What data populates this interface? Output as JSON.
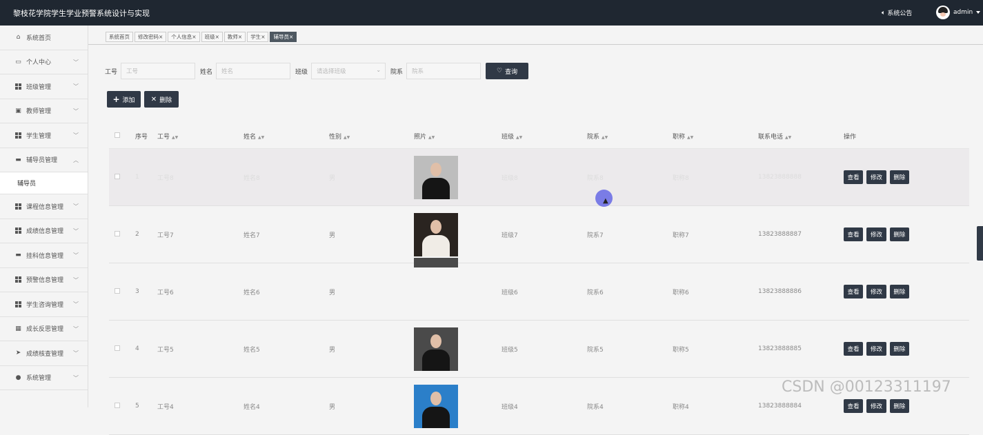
{
  "header": {
    "title": "黎枝花学院学生学业预警系统设计与实现",
    "notice_label": "系统公告",
    "username": "admin"
  },
  "sidebar": {
    "items": [
      {
        "label": "系统首页",
        "icon": "home-icon",
        "expanded": false
      },
      {
        "label": "个人中心",
        "icon": "profile-icon",
        "expanded": false
      },
      {
        "label": "班级管理",
        "icon": "grid-icon",
        "expanded": false
      },
      {
        "label": "教师管理",
        "icon": "clipboard-icon",
        "expanded": false
      },
      {
        "label": "学生管理",
        "icon": "grid-icon",
        "expanded": false
      },
      {
        "label": "辅导员管理",
        "icon": "monitor-icon",
        "expanded": true
      },
      {
        "label": "课程信息管理",
        "icon": "grid-icon",
        "expanded": false
      },
      {
        "label": "成绩信息管理",
        "icon": "grid-icon",
        "expanded": false
      },
      {
        "label": "挂科信息管理",
        "icon": "monitor-icon",
        "expanded": false
      },
      {
        "label": "预警信息管理",
        "icon": "grid-icon",
        "expanded": false
      },
      {
        "label": "学生咨询管理",
        "icon": "grid-icon",
        "expanded": false
      },
      {
        "label": "成长反思管理",
        "icon": "chart-icon",
        "expanded": false
      },
      {
        "label": "成绩核查管理",
        "icon": "send-icon",
        "expanded": false
      },
      {
        "label": "系统管理",
        "icon": "user-icon",
        "expanded": false
      }
    ],
    "sub_item": "辅导员"
  },
  "tabs": [
    {
      "label": "系统首页",
      "closable": false,
      "active": false
    },
    {
      "label": "修改密码",
      "closable": true,
      "active": false
    },
    {
      "label": "个人信息",
      "closable": true,
      "active": false
    },
    {
      "label": "班级",
      "closable": true,
      "active": false
    },
    {
      "label": "教师",
      "closable": true,
      "active": false
    },
    {
      "label": "学生",
      "closable": true,
      "active": false
    },
    {
      "label": "辅导员",
      "closable": true,
      "active": true
    }
  ],
  "filters": {
    "id_label": "工号",
    "id_placeholder": "工号",
    "name_label": "姓名",
    "name_placeholder": "姓名",
    "class_label": "班级",
    "class_placeholder": "请选择班级",
    "dept_label": "院系",
    "dept_placeholder": "院系",
    "search_button": "查询"
  },
  "toolbar": {
    "add_label": "添加",
    "delete_label": "删除"
  },
  "table": {
    "columns": [
      "序号",
      "工号",
      "姓名",
      "性别",
      "照片",
      "班级",
      "院系",
      "职称",
      "联系电话",
      "操作"
    ],
    "rows": [
      {
        "index": "1",
        "id": "工号8",
        "name": "姓名8",
        "gender": "男",
        "class": "班级8",
        "dept": "院系8",
        "title": "职称8",
        "phone": "13823888888"
      },
      {
        "index": "2",
        "id": "工号7",
        "name": "姓名7",
        "gender": "男",
        "class": "班级7",
        "dept": "院系7",
        "title": "职称7",
        "phone": "13823888887"
      },
      {
        "index": "3",
        "id": "工号6",
        "name": "姓名6",
        "gender": "男",
        "class": "班级6",
        "dept": "院系6",
        "title": "职称6",
        "phone": "13823888886"
      },
      {
        "index": "4",
        "id": "工号5",
        "name": "姓名5",
        "gender": "男",
        "class": "班级5",
        "dept": "院系5",
        "title": "职称5",
        "phone": "13823888885"
      },
      {
        "index": "5",
        "id": "工号4",
        "name": "姓名4",
        "gender": "男",
        "class": "班级4",
        "dept": "院系4",
        "title": "职称4",
        "phone": "13823888884"
      }
    ],
    "actions": {
      "view": "查看",
      "edit": "修改",
      "delete": "删除"
    }
  },
  "watermark": "CSDN @00123311197"
}
